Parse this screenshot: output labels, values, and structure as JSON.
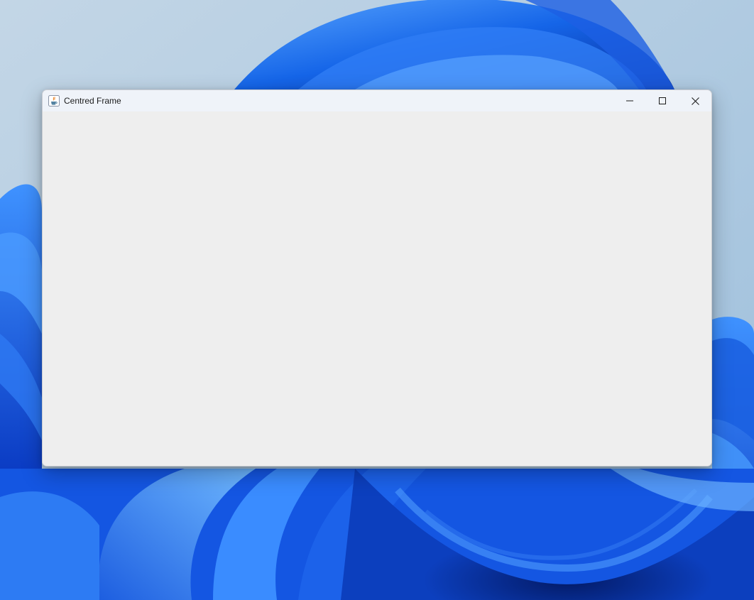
{
  "window": {
    "title": "Centred Frame",
    "app_icon": "java-coffee-cup-icon",
    "controls": {
      "minimize_icon": "minimize-icon",
      "maximize_icon": "maximize-icon",
      "close_icon": "close-icon"
    }
  },
  "colors": {
    "titlebar": "#eff3f9",
    "content": "#eeeeee",
    "wallpaper_blue": "#1a6df0"
  }
}
